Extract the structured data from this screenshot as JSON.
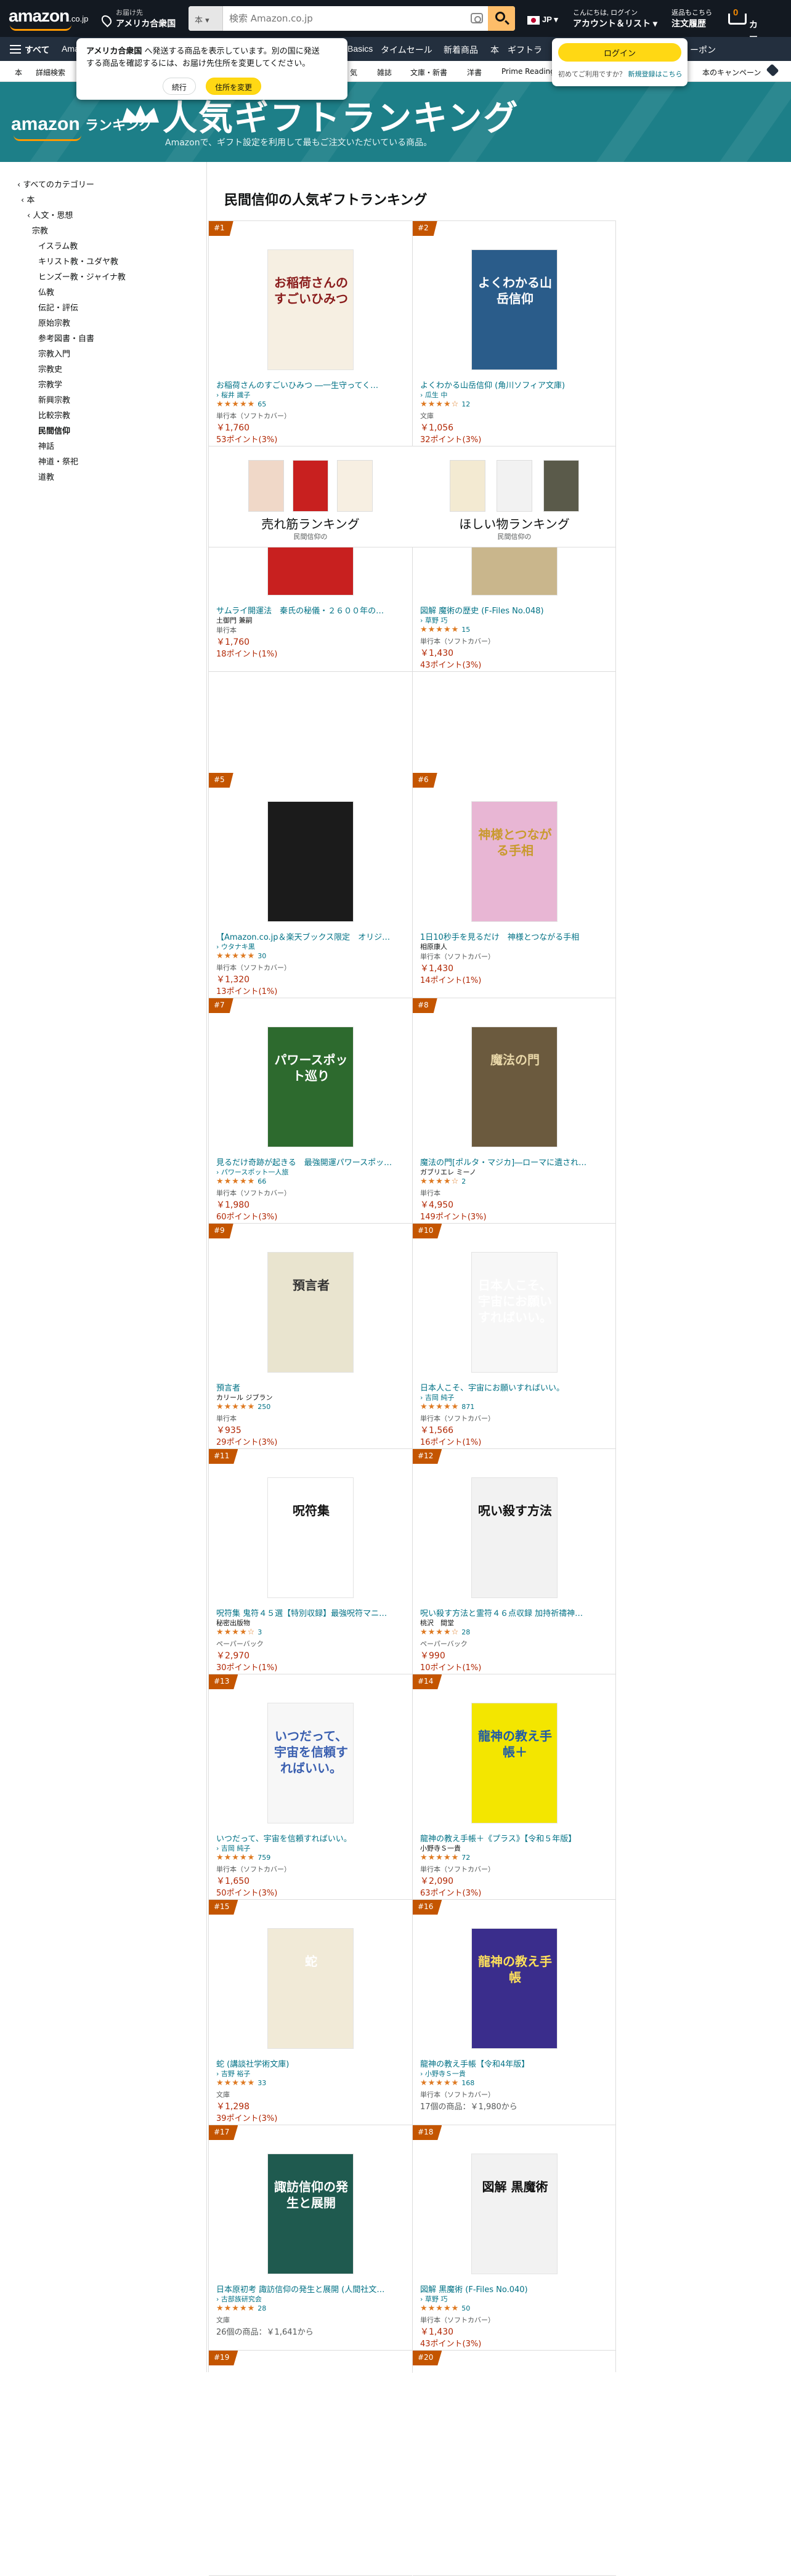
{
  "header": {
    "logo": "amazon",
    "logo_suffix": ".co.jp",
    "deliver_line1": "お届け先",
    "deliver_line2": "アメリカ合衆国",
    "search_dept": "本",
    "search_placeholder": "検索 Amazon.co.jp",
    "language": "JP",
    "account_line1": "こんにちは, ログイン",
    "account_line2": "アカウント＆リスト",
    "orders_line1": "返品もこちら",
    "orders_line2": "注文履歴",
    "cart_count": "0",
    "cart_label": "カート"
  },
  "main_nav": {
    "all_label": "すべて",
    "items": [
      "Amazon",
      "Basics",
      "タイムセール",
      "新着商品",
      "本",
      "ギフトラ",
      "ーポン"
    ]
  },
  "sub_nav": {
    "items": [
      "本",
      "詳細検索",
      "気",
      "雑誌",
      "文庫・新書",
      "洋書",
      "Prime Reading",
      "本のキャンペーン"
    ]
  },
  "popup": {
    "bold": "アメリカ合衆国",
    "text1": " へ発送する商品を表示しています。別の国に発送",
    "text2": "する商品を確認するには、お届け先住所を変更してください。",
    "continue_label": "続行",
    "change_label": "住所を変更"
  },
  "login_popup": {
    "button_label": "ログイン",
    "new_text": "初めてご利用ですか？",
    "new_link": "新規登録はこちら"
  },
  "banner": {
    "logo": "amazon",
    "logo_suffix": "ランキング",
    "title": "人気ギフトランキング",
    "subtitle": "Amazonで、ギフト設定を利用して最もご注文いただいている商品。"
  },
  "sidebar": {
    "items": [
      {
        "label": "‹ すべてのカテゴリー",
        "bold": false
      },
      {
        "label": "‹ 本",
        "bold": false
      },
      {
        "label": "‹ 人文・思想",
        "bold": false
      },
      {
        "label": "宗教",
        "bold": false
      },
      {
        "label": "イスラム教",
        "bold": false
      },
      {
        "label": "キリスト教・ユダヤ教",
        "bold": false
      },
      {
        "label": "ヒンズー教・ジャイナ教",
        "bold": false
      },
      {
        "label": "仏教",
        "bold": false
      },
      {
        "label": "伝記・評伝",
        "bold": false
      },
      {
        "label": "原始宗教",
        "bold": false
      },
      {
        "label": "参考図書・自書",
        "bold": false
      },
      {
        "label": "宗教入門",
        "bold": false
      },
      {
        "label": "宗教史",
        "bold": false
      },
      {
        "label": "宗教学",
        "bold": false
      },
      {
        "label": "新興宗教",
        "bold": false
      },
      {
        "label": "比較宗教",
        "bold": false
      },
      {
        "label": "民間信仰",
        "bold": true
      },
      {
        "label": "神話",
        "bold": false
      },
      {
        "label": "神道・祭祀",
        "bold": false
      },
      {
        "label": "道教",
        "bold": false
      }
    ]
  },
  "page_title": "民間信仰の人気ギフトランキング",
  "promo": {
    "left_label": "売れ筋ランキング",
    "left_sub": "民間信仰の",
    "right_label": "ほしい物ランキング",
    "right_sub": "民間信仰の"
  },
  "products": [
    {
      "rank": "#1",
      "title": "お稲荷さんのすごいひみつ ―一生守ってく…",
      "author": "› 桜井 識子",
      "author_link": true,
      "rating": 4.5,
      "rating_count": "65",
      "format": "単行本（ソフトカバー）",
      "price": "￥1,760",
      "points": "53ポイント(3%)",
      "offers": "",
      "cover_bg": "#f6efe2",
      "cover_text": "お稲荷さんのすごいひみつ",
      "cover_color": "#8a1c1c"
    },
    {
      "rank": "#2",
      "title": "よくわかる山岳信仰 (角川ソフィア文庫)",
      "author": "› 瓜生 中",
      "author_link": true,
      "rating": 4,
      "rating_count": "12",
      "format": "文庫",
      "price": "￥1,056",
      "points": "32ポイント(3%)",
      "offers": "",
      "cover_bg": "#2a5c8a",
      "cover_text": "よくわかる山岳信仰",
      "cover_color": "#ffffff"
    },
    {
      "rank": "#3",
      "title": "サムライ開運法　秦氏の秘儀・２６００年の…",
      "author": "土御門 兼嗣",
      "author_link": false,
      "rating": 0,
      "rating_count": "",
      "format": "単行本",
      "price": "￥1,760",
      "points": "18ポイント(1%)",
      "offers": "",
      "cover_bg": "#c8201f",
      "cover_text": "サムライ開運法",
      "cover_color": "#ffe15a"
    },
    {
      "rank": "#4",
      "title": "図解 魔術の歴史 (F-Files No.048)",
      "author": "› 草野 巧",
      "author_link": true,
      "rating": 4.5,
      "rating_count": "15",
      "format": "単行本（ソフトカバー）",
      "price": "￥1,430",
      "points": "43ポイント(3%)",
      "offers": "",
      "cover_bg": "#c9b68c",
      "cover_text": "図解 魔術の歴史",
      "cover_color": "#5a1e10"
    },
    {
      "rank": "#5",
      "title": "【Amazon.co.jp＆楽天ブックス限定　オリジ…",
      "author": "› ウタナキ黒",
      "author_link": true,
      "rating": 4.5,
      "rating_count": "30",
      "format": "単行本（ソフトカバー）",
      "price": "￥1,320",
      "points": "13ポイント(1%)",
      "offers": "",
      "cover_bg": "#1b1b1b",
      "cover_text": "",
      "cover_color": "#ffffff"
    },
    {
      "rank": "#6",
      "title": "1日10秒手を見るだけ　神様とつながる手相",
      "author": "相原康人",
      "author_link": false,
      "rating": 0,
      "rating_count": "",
      "format": "単行本（ソフトカバー）",
      "price": "￥1,430",
      "points": "14ポイント(1%)",
      "offers": "",
      "cover_bg": "#e8b6d4",
      "cover_text": "神様とつながる手相",
      "cover_color": "#c99a2e"
    },
    {
      "rank": "#7",
      "title": "見るだけ奇跡が起きる　最強開運パワースポッ…",
      "author": "› パワースポット一人旅",
      "author_link": true,
      "rating": 4.5,
      "rating_count": "66",
      "format": "単行本（ソフトカバー）",
      "price": "￥1,980",
      "points": "60ポイント(3%)",
      "offers": "",
      "cover_bg": "#2d6a2e",
      "cover_text": "パワースポット巡り",
      "cover_color": "#ffffff"
    },
    {
      "rank": "#8",
      "title": "魔法の門[ポルタ・マジカ]―ローマに遺され…",
      "author": "ガブリエレ ミーノ",
      "author_link": false,
      "rating": 4,
      "rating_count": "2",
      "format": "単行本",
      "price": "￥4,950",
      "points": "149ポイント(3%)",
      "offers": "",
      "cover_bg": "#6b5a3e",
      "cover_text": "魔法の門",
      "cover_color": "#e8d7a8"
    },
    {
      "rank": "#9",
      "title": "預言者",
      "author": "カリール ジブラン",
      "author_link": false,
      "rating": 4.5,
      "rating_count": "250",
      "format": "単行本",
      "price": "￥935",
      "points": "29ポイント(3%)",
      "offers": "",
      "cover_bg": "#e9e4cf",
      "cover_text": "預言者",
      "cover_color": "#333333"
    },
    {
      "rank": "#10",
      "title": "日本人こそ、宇宙にお願いすればいい。",
      "author": "› 吉岡 純子",
      "author_link": true,
      "rating": 4.5,
      "rating_count": "871",
      "format": "単行本（ソフトカバー）",
      "price": "￥1,566",
      "points": "16ポイント(1%)",
      "offers": "",
      "cover_bg": "#f7f7f7",
      "cover_text": "日本人こそ、宇宙にお願いすればいい。",
      "cover_color": "#ffffff"
    },
    {
      "rank": "#11",
      "title": "呪符集 鬼符４５選【特別収録】最強呪符マニ…",
      "author": "秘密出版物",
      "author_link": false,
      "rating": 3.5,
      "rating_count": "3",
      "format": "ペーパーバック",
      "price": "￥2,970",
      "points": "30ポイント(1%)",
      "offers": "",
      "cover_bg": "#ffffff",
      "cover_text": "呪符集",
      "cover_color": "#111111"
    },
    {
      "rank": "#12",
      "title": "呪い殺す方法と霊符４６点収録 加持祈禱神…",
      "author": "桃沢　間堂",
      "author_link": false,
      "rating": 3.5,
      "rating_count": "28",
      "format": "ペーパーバック",
      "price": "￥990",
      "points": "10ポイント(1%)",
      "offers": "",
      "cover_bg": "#f2f2f2",
      "cover_text": "呪い殺す方法",
      "cover_color": "#111111"
    },
    {
      "rank": "#13",
      "title": "いつだって、宇宙を信頼すればいい。",
      "author": "› 吉岡 純子",
      "author_link": true,
      "rating": 4.5,
      "rating_count": "759",
      "format": "単行本（ソフトカバー）",
      "price": "￥1,650",
      "points": "50ポイント(3%)",
      "offers": "",
      "cover_bg": "#f7f7f7",
      "cover_text": "いつだって、宇宙を信頼すればいい。",
      "cover_color": "#3a5fb0"
    },
    {
      "rank": "#14",
      "title": "龍神の教え手帳＋《プラス》【令和５年版】",
      "author": "小野寺Ｓ一貴",
      "author_link": false,
      "rating": 4.5,
      "rating_count": "72",
      "format": "単行本（ソフトカバー）",
      "price": "￥2,090",
      "points": "63ポイント(3%)",
      "offers": "",
      "cover_bg": "#f3e600",
      "cover_text": "龍神の教え手帳＋",
      "cover_color": "#1e5aa8"
    },
    {
      "rank": "#15",
      "title": "蛇 (講談社学術文庫)",
      "author": "› 吉野 裕子",
      "author_link": true,
      "rating": 4.5,
      "rating_count": "33",
      "format": "文庫",
      "price": "￥1,298",
      "points": "39ポイント(3%)",
      "offers": "",
      "cover_bg": "#f1ead7",
      "cover_text": "蛇",
      "cover_color": "#ffffff"
    },
    {
      "rank": "#16",
      "title": "龍神の教え手帳【令和4年版】",
      "author": "› 小野寺Ｓ一貴",
      "author_link": true,
      "rating": 4.5,
      "rating_count": "168",
      "format": "単行本（ソフトカバー）",
      "price": "",
      "points": "",
      "offers": "17個の商品：￥1,980から",
      "cover_bg": "#3a2d8c",
      "cover_text": "龍神の教え手帳",
      "cover_color": "#ffe15a"
    },
    {
      "rank": "#17",
      "title": "日本原初考 諏訪信仰の発生と展開 (人間社文…",
      "author": "› 古部族研究会",
      "author_link": true,
      "rating": 4.5,
      "rating_count": "28",
      "format": "文庫",
      "price": "",
      "points": "",
      "offers": "26個の商品：￥1,641から",
      "cover_bg": "#1f5a4f",
      "cover_text": "諏訪信仰の発生と展開",
      "cover_color": "#ffffff"
    },
    {
      "rank": "#18",
      "title": "図解 黒魔術 (F-Files No.040)",
      "author": "› 草野 巧",
      "author_link": true,
      "rating": 4.5,
      "rating_count": "50",
      "format": "単行本（ソフトカバー）",
      "price": "￥1,430",
      "points": "43ポイント(3%)",
      "offers": "",
      "cover_bg": "#f2f2f2",
      "cover_text": "図解 黒魔術",
      "cover_color": "#111111"
    },
    {
      "rank": "#19",
      "title": "",
      "author": "",
      "author_link": false,
      "rating": 0,
      "rating_count": "",
      "format": "",
      "price": "",
      "points": "",
      "offers": "",
      "cover_bg": "#ffffff",
      "cover_text": "",
      "cover_color": "#111111"
    },
    {
      "rank": "#20",
      "title": "",
      "author": "",
      "author_link": false,
      "rating": 0,
      "rating_count": "",
      "format": "",
      "price": "",
      "points": "",
      "offers": "",
      "cover_bg": "#ffffff",
      "cover_text": "",
      "cover_color": "#111111"
    }
  ],
  "colors": {
    "nav_dark": "#131921",
    "nav_main": "#232f3e",
    "banner": "#1d7f88",
    "rank_badge": "#c45500",
    "link": "#007185",
    "price": "#b12704",
    "star": "#de7921",
    "button_yellow": "#ffd814"
  }
}
